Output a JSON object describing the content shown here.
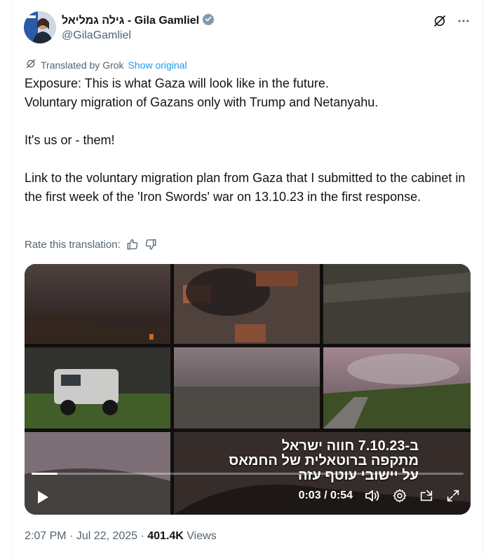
{
  "author": {
    "name": "גילה גמליאל - Gila Gamliel",
    "handle": "@GilaGamliel",
    "verified_badge": "verified-badge-icon",
    "badge_color": "#829aab"
  },
  "header_icons": [
    "grok-icon",
    "more-icon"
  ],
  "translation": {
    "label": "Translated by Grok",
    "show_original": "Show original",
    "link_color": "#1d9bf0"
  },
  "tweet": {
    "line1": "Exposure: This is what Gaza will look like in the future.\nVoluntary migration of Gazans only with Trump and Netanyahu.",
    "line2": "It's us or - them!",
    "line3": "Link to the voluntary migration plan from Gaza that I submitted to the cabinet in the first week of the 'Iron Swords' war on 13.10.23 in the first response."
  },
  "rate": {
    "label": "Rate this translation:"
  },
  "video": {
    "caption": [
      "ב-7.10.23 חווה ישראל",
      "מתקפה ברוטאלית של החמאס",
      "על יישובי עוטף עזה"
    ],
    "current_time": "0:03",
    "separator": "/",
    "duration": "0:54",
    "progress": 0.06
  },
  "meta": {
    "time": "2:07 PM",
    "date": "Jul 22, 2025",
    "dot": "·",
    "views_count": "401.4K",
    "views_label": "Views"
  }
}
